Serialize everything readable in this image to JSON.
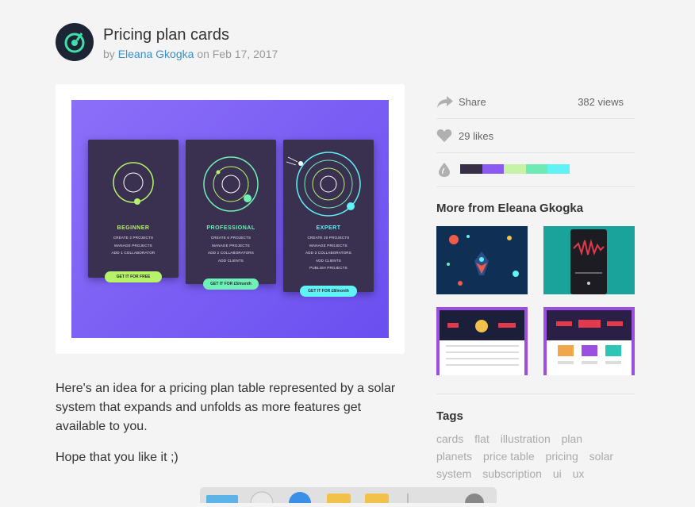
{
  "shot": {
    "title": "Pricing plan cards",
    "by": "by",
    "author": "Eleana Gkogka",
    "on": "on",
    "date": "Feb 17, 2017"
  },
  "preview": {
    "plans": [
      {
        "name": "BEGINNER",
        "color": "#b6f36a",
        "features": [
          "CREATE 2 PROJECTS",
          "MANAGE PROJECTS",
          "ADD 1 COLLABORATOR"
        ],
        "button": "GET IT FOR FREE"
      },
      {
        "name": "PROFESSIONAL",
        "color": "#6ff0b4",
        "features": [
          "CREATE 6 PROJECTS",
          "MANAGE PROJECTS",
          "ADD 2 COLLABORATORS",
          "ADD CLIENTS"
        ],
        "button": "GET IT FOR £5/month"
      },
      {
        "name": "EXPERT",
        "color": "#5ff3f5",
        "features": [
          "CREATE 20 PROJECTS",
          "MANAGE PROJECTS",
          "ADD 3 COLLABORATORS",
          "ADD CLIENTS",
          "PUBLISH PROJECTS"
        ],
        "button": "GET IT FOR £8/month"
      }
    ]
  },
  "description": {
    "paragraph1": "Here's an idea for a pricing plan table represented by a solar system that expands and unfolds as more features get available to you.",
    "paragraph2": "Hope that you like it ;)"
  },
  "sidebar": {
    "share_label": "Share",
    "views": "382 views",
    "likes": "29 likes",
    "palette": [
      "#372f46",
      "#8a5af2",
      "#c8f2a8",
      "#6eeab4",
      "#5ff3f5"
    ],
    "more_title": "More from Eleana Gkogka",
    "tags_title": "Tags",
    "tags": [
      "cards",
      "flat",
      "illustration",
      "plan",
      "planets",
      "price table",
      "pricing",
      "solar system",
      "subscription",
      "ui",
      "ux"
    ]
  },
  "icons": {
    "avatar": "dribbble-logo-icon",
    "share": "share-arrow-icon",
    "likes": "heart-icon",
    "colors": "droplet-icon"
  }
}
